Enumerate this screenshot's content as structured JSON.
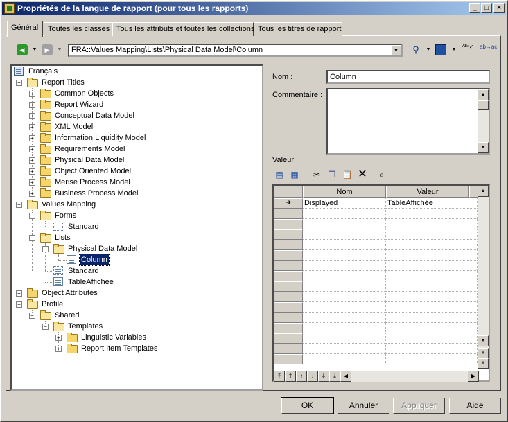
{
  "window": {
    "title": "Propriétés de la langue de rapport (pour tous les rapports)",
    "controls": {
      "minimize": "_",
      "maximize": "□",
      "close": "×"
    }
  },
  "tabs": [
    {
      "label": "Général",
      "active": true
    },
    {
      "label": "Toutes les classes",
      "active": false
    },
    {
      "label": "Tous les attributs et toutes les collections",
      "active": false
    },
    {
      "label": "Tous les titres de rapport",
      "active": false
    }
  ],
  "toolbar": {
    "path": "FRA::Values Mapping\\Lists\\Physical Data Model\\Column"
  },
  "tree": {
    "root": "Français",
    "report_titles": "Report Titles",
    "report_titles_children": [
      "Common Objects",
      "Report Wizard",
      "Conceptual Data Model",
      "XML Model",
      "Information Liquidity Model",
      "Requirements Model",
      "Physical Data Model",
      "Object Oriented Model",
      "Merise Process Model",
      "Business Process Model"
    ],
    "values_mapping": "Values Mapping",
    "forms": "Forms",
    "forms_standard": "Standard",
    "lists": "Lists",
    "pdm": "Physical Data Model",
    "column": "Column",
    "lists_standard": "Standard",
    "table_affichee": "TableAffichée",
    "object_attributes": "Object Attributes",
    "profile": "Profile",
    "shared": "Shared",
    "templates": "Templates",
    "linguistic_variables": "Linguistic Variables",
    "report_item_templates": "Report Item Templates"
  },
  "form": {
    "nom_label": "Nom :",
    "nom_value": "Column",
    "commentaire_label": "Commentaire :",
    "commentaire_value": "",
    "valeur_label": "Valeur :"
  },
  "grid": {
    "columns": [
      "Nom",
      "Valeur"
    ],
    "rows": [
      {
        "nom": "Displayed",
        "valeur": "TableAffichée"
      }
    ]
  },
  "buttons": {
    "ok": "OK",
    "annuler": "Annuler",
    "appliquer": "Appliquer",
    "aide": "Aide"
  }
}
